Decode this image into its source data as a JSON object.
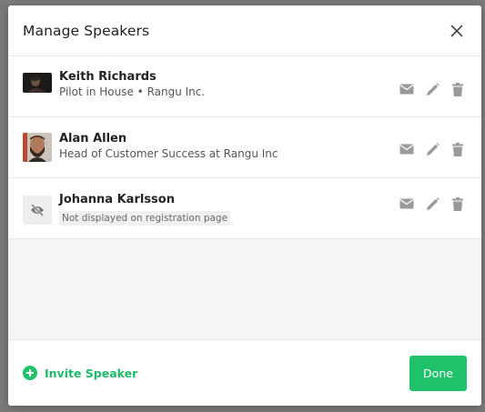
{
  "modal": {
    "title": "Manage Speakers"
  },
  "speakers": [
    {
      "name": "Keith Richards",
      "subtitle": "Pilot in House • Rangu Inc.",
      "avatar": "photo"
    },
    {
      "name": "Alan Allen",
      "subtitle": "Head of Customer Success at Rangu Inc",
      "avatar": "photo"
    },
    {
      "name": "Johanna Karlsson",
      "note": "Not displayed on registration page",
      "avatar": "eye-off-icon"
    }
  ],
  "row_actions": [
    "mail-icon",
    "pencil-icon",
    "trash-icon"
  ],
  "footer": {
    "invite_label": "Invite Speaker",
    "done_label": "Done"
  },
  "colors": {
    "accent": "#1fc16b",
    "icon_gray": "#9a9a9a",
    "overlay": "#7a7a7a"
  }
}
